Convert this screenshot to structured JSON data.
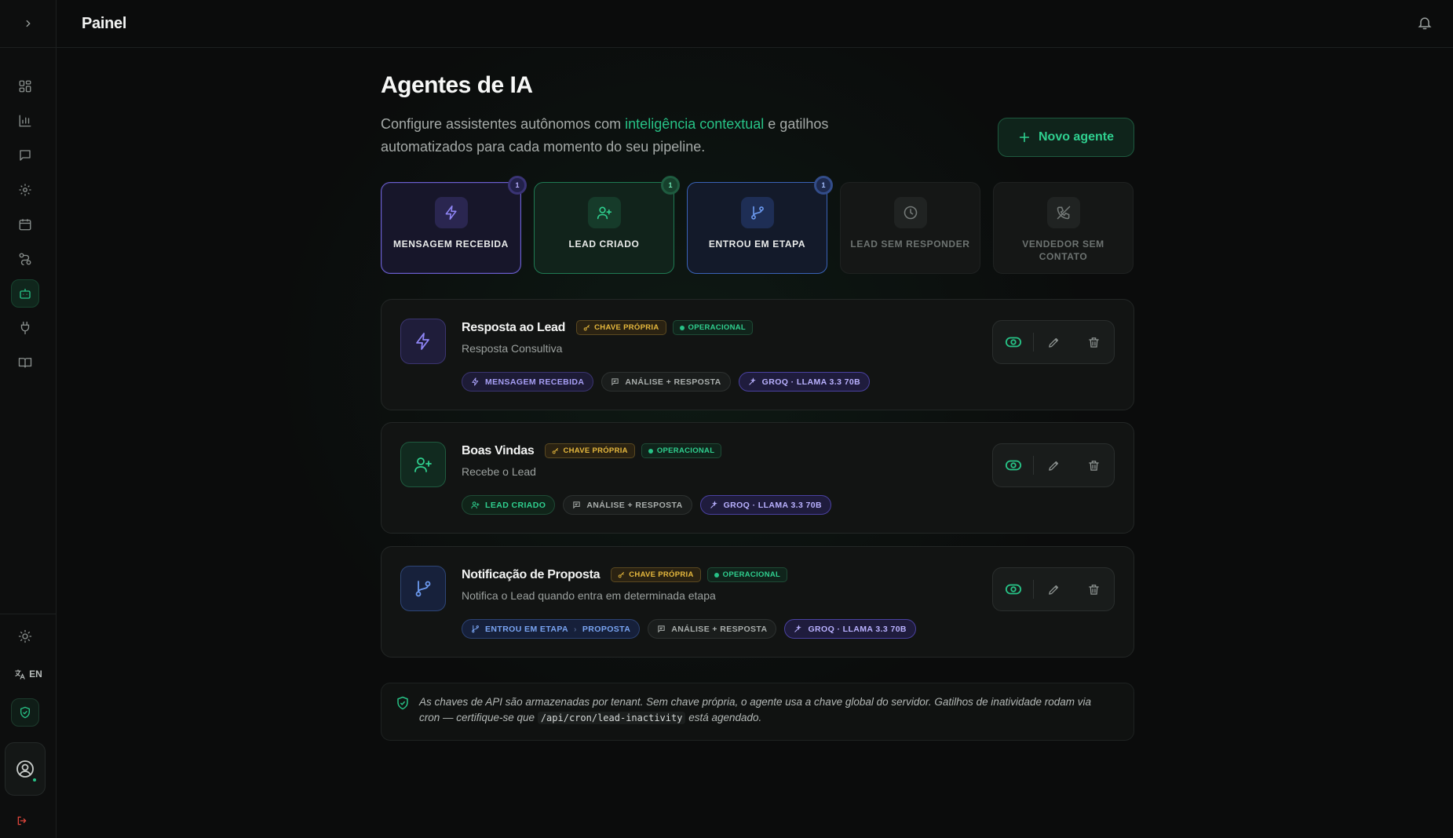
{
  "header": {
    "title": "Painel"
  },
  "sidebar": {
    "items": [
      {
        "name": "dashboard",
        "icon": "grid-icon"
      },
      {
        "name": "reports",
        "icon": "bar-chart-icon"
      },
      {
        "name": "messages",
        "icon": "message-icon"
      },
      {
        "name": "settings",
        "icon": "gear-icon"
      },
      {
        "name": "calendar",
        "icon": "calendar-icon"
      },
      {
        "name": "pipeline",
        "icon": "route-icon"
      },
      {
        "name": "agents",
        "icon": "bot-icon",
        "active": true
      },
      {
        "name": "integrations",
        "icon": "plug-icon"
      },
      {
        "name": "docs",
        "icon": "book-icon"
      }
    ],
    "language": "EN"
  },
  "page": {
    "title": "Agentes de IA",
    "desc_before": "Configure assistentes autônomos com ",
    "desc_highlight": "inteligência contextual",
    "desc_after": " e gatilhos automatizados para cada momento do seu pipeline.",
    "new_button": "Novo agente"
  },
  "triggers": [
    {
      "label": "MENSAGEM RECEBIDA",
      "badge": "1",
      "color": "#8f85f5"
    },
    {
      "label": "LEAD CRIADO",
      "badge": "1",
      "color": "#2fd08f"
    },
    {
      "label": "ENTROU EM ETAPA",
      "badge": "1",
      "color": "#6c9af0"
    },
    {
      "label": "LEAD SEM RESPONDER",
      "badge": null
    },
    {
      "label": "VENDEDOR SEM CONTATO",
      "badge": null
    }
  ],
  "agents": [
    {
      "name": "Resposta ao Lead",
      "key_badge": "CHAVE PRÓPRIA",
      "status": "OPERACIONAL",
      "description": "Resposta Consultiva",
      "trigger_tag": "MENSAGEM RECEBIDA",
      "action_tag": "ANÁLISE + RESPOSTA",
      "model_tag": "GROQ · LLAMA 3.3 70B"
    },
    {
      "name": "Boas Vindas",
      "key_badge": "CHAVE PRÓPRIA",
      "status": "OPERACIONAL",
      "description": "Recebe o Lead",
      "trigger_tag": "LEAD CRIADO",
      "action_tag": "ANÁLISE + RESPOSTA",
      "model_tag": "GROQ · LLAMA 3.3 70B"
    },
    {
      "name": "Notificação de Proposta",
      "key_badge": "CHAVE PRÓPRIA",
      "status": "OPERACIONAL",
      "description": "Notifica o Lead quando entra em determinada etapa",
      "trigger_tag": "ENTROU EM ETAPA",
      "trigger_stage": "PROPOSTA",
      "action_tag": "ANÁLISE + RESPOSTA",
      "model_tag": "GROQ · LLAMA 3.3 70B"
    }
  ],
  "notice": {
    "before": "As chaves de API são armazenadas por tenant. Sem chave própria, o agente usa a chave global do servidor. Gatilhos de inatividade rodam via cron — certifique-se que ",
    "code": "/api/cron/lead-inactivity",
    "after": " está agendado."
  }
}
